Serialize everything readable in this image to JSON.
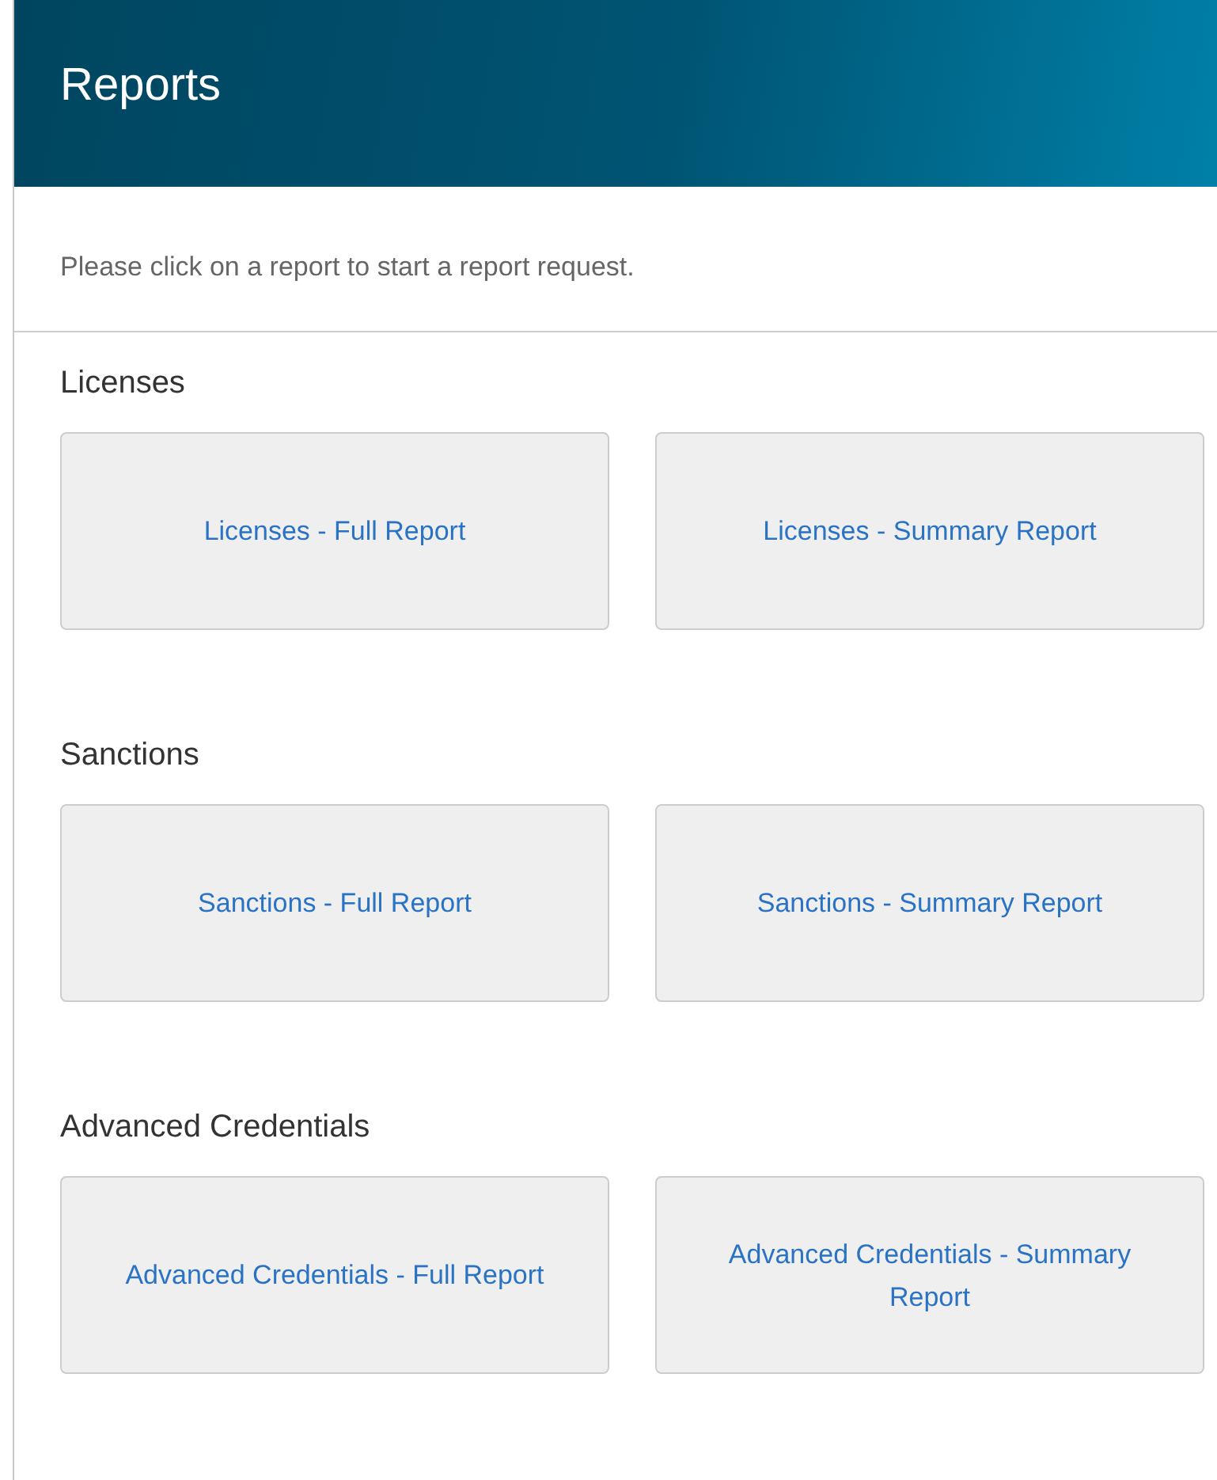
{
  "header": {
    "title": "Reports"
  },
  "intro": "Please click on a report to start a report request.",
  "sections": [
    {
      "title": "Licenses",
      "reports": [
        "Licenses - Full Report",
        "Licenses - Summary Report"
      ]
    },
    {
      "title": "Sanctions",
      "reports": [
        "Sanctions - Full Report",
        "Sanctions - Summary Report"
      ]
    },
    {
      "title": "Advanced Credentials",
      "reports": [
        "Advanced Credentials - Full Report",
        "Advanced Credentials - Summary Report"
      ]
    }
  ]
}
